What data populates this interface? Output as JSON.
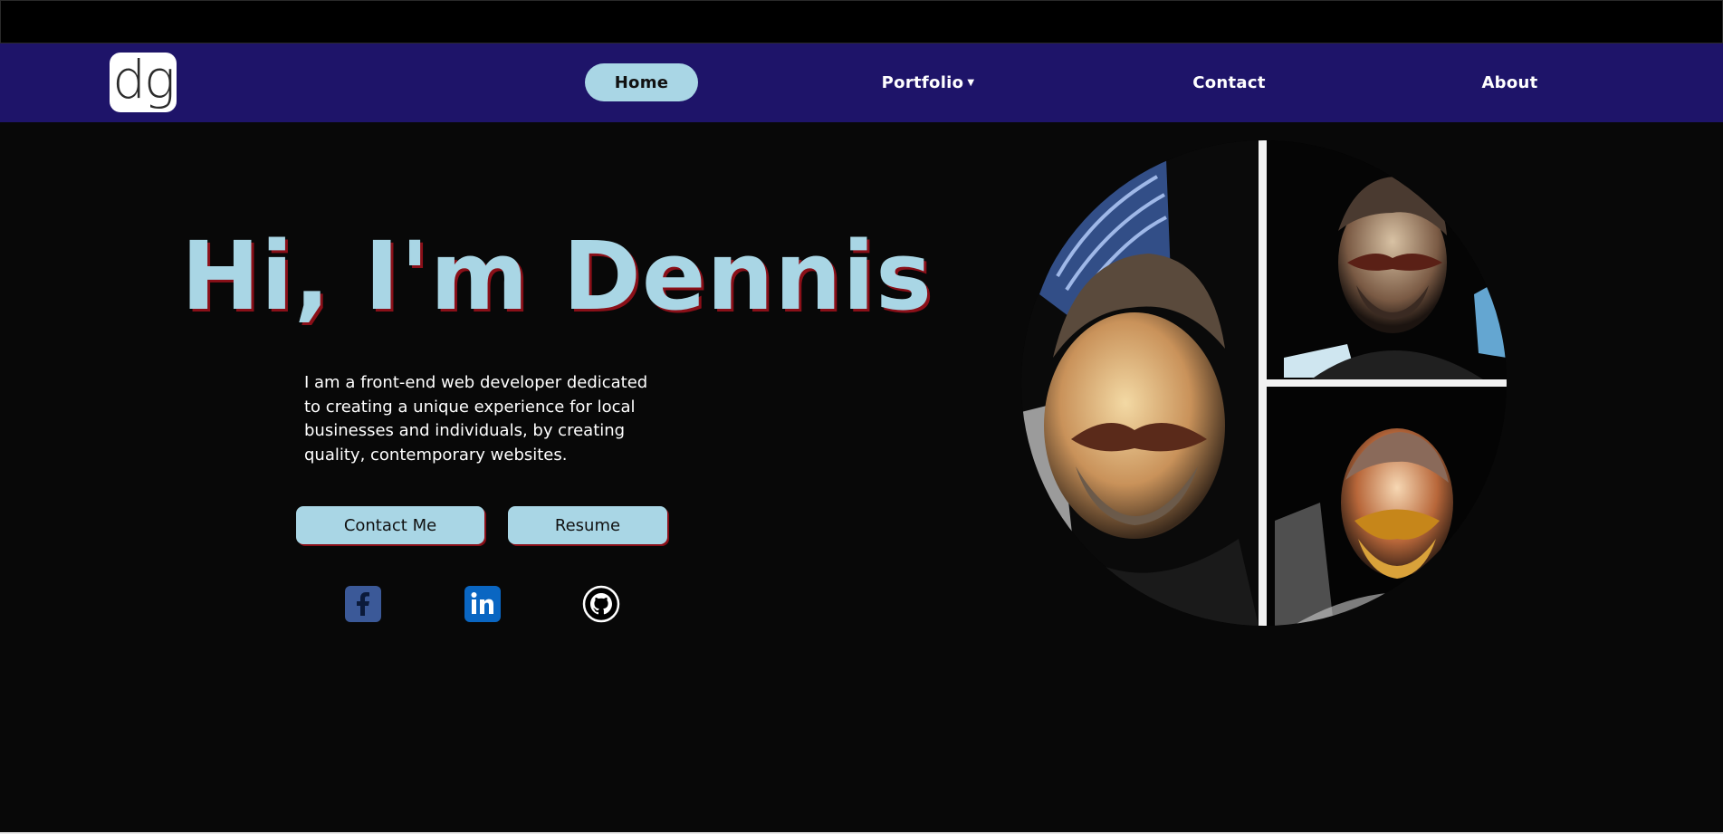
{
  "nav": {
    "logo_text": "dg",
    "items": [
      {
        "label": "Home",
        "active": true
      },
      {
        "label": "Portfolio",
        "has_dropdown": true
      },
      {
        "label": "Contact"
      },
      {
        "label": "About"
      }
    ],
    "caret_icon": "caret-down-icon"
  },
  "hero": {
    "title": "Hi, I'm Dennis",
    "intro": "I am a front-end web developer dedicated to creating a unique experience for local businesses and individuals, by creating quality, contemporary websites.",
    "buttons": {
      "contact": "Contact Me",
      "resume": "Resume"
    },
    "social_icons": [
      "facebook-icon",
      "linkedin-icon",
      "github-icon"
    ]
  },
  "colors": {
    "nav_bg": "#1e1469",
    "accent": "#a9d6e5",
    "shadow": "#8a0f18",
    "page_bg": "#080808"
  }
}
